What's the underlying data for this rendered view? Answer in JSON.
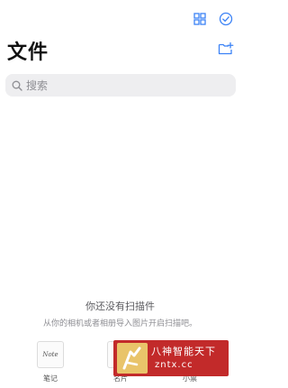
{
  "header": {
    "title": "文件",
    "grid_view_icon": "grid-icon",
    "select_icon": "check-circle-icon",
    "new_folder_icon": "folder-add-icon"
  },
  "search": {
    "placeholder": "搜索",
    "value": "",
    "icon": "search-icon"
  },
  "empty_state": {
    "title": "你还没有扫描件",
    "subtitle": "从你的相机或者相册导入图片开启扫描吧。"
  },
  "shortcuts": [
    {
      "label": "笔记",
      "tile_text": "Note"
    },
    {
      "label": "名片"
    },
    {
      "label": "小票"
    }
  ],
  "watermark": {
    "line1": "八神智能天下",
    "line2": "zntx.cc"
  },
  "colors": {
    "accent": "#3b82f6",
    "search_bg": "#eeeef0",
    "watermark_bg": "#c22a2a"
  }
}
